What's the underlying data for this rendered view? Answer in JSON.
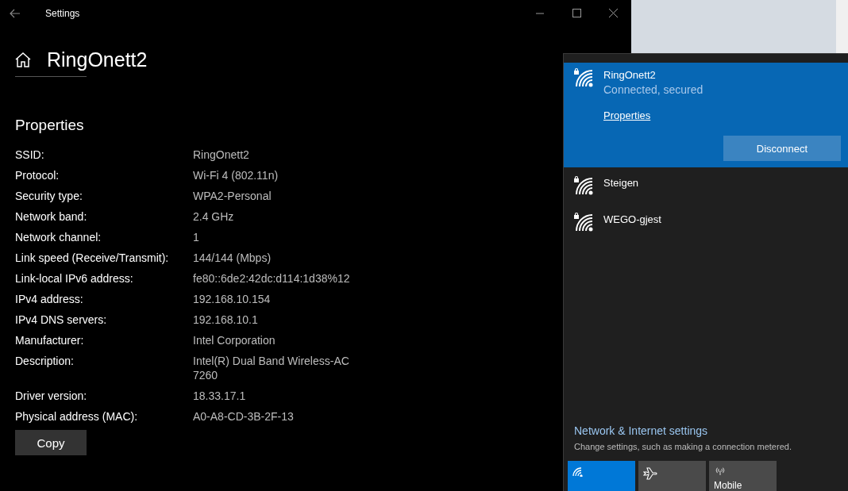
{
  "window": {
    "title": "Settings"
  },
  "header": {
    "title": "RingOnett2"
  },
  "properties": {
    "heading": "Properties",
    "rows": [
      {
        "label": "SSID:",
        "value": "RingOnett2"
      },
      {
        "label": "Protocol:",
        "value": "Wi-Fi 4 (802.11n)"
      },
      {
        "label": "Security type:",
        "value": "WPA2-Personal"
      },
      {
        "label": "Network band:",
        "value": "2.4 GHz"
      },
      {
        "label": "Network channel:",
        "value": "1"
      },
      {
        "label": "Link speed (Receive/Transmit):",
        "value": "144/144 (Mbps)"
      },
      {
        "label": "Link-local IPv6 address:",
        "value": "fe80::6de2:42dc:d114:1d38%12"
      },
      {
        "label": "IPv4 address:",
        "value": "192.168.10.154"
      },
      {
        "label": "IPv4 DNS servers:",
        "value": "192.168.10.1"
      },
      {
        "label": "Manufacturer:",
        "value": "Intel Corporation"
      },
      {
        "label": "Description:",
        "value": "Intel(R) Dual Band Wireless-AC 7260"
      },
      {
        "label": "Driver version:",
        "value": "18.33.17.1"
      },
      {
        "label": "Physical address (MAC):",
        "value": "A0-A8-CD-3B-2F-13"
      }
    ],
    "copy_button": "Copy"
  },
  "flyout": {
    "networks": [
      {
        "name": "RingOnett2",
        "status": "Connected, secured",
        "link": "Properties",
        "button": "Disconnect",
        "expanded": true
      },
      {
        "name": "Steigen",
        "expanded": false
      },
      {
        "name": "WEGO-gjest",
        "expanded": false
      }
    ],
    "settings_link": "Network & Internet settings",
    "settings_hint": "Change settings, such as making a connection metered.",
    "tiles": [
      {
        "kind": "wifi",
        "on": true
      },
      {
        "kind": "airplane",
        "on": false
      },
      {
        "kind": "hotspot",
        "label": "Mobile",
        "on": false
      }
    ]
  }
}
